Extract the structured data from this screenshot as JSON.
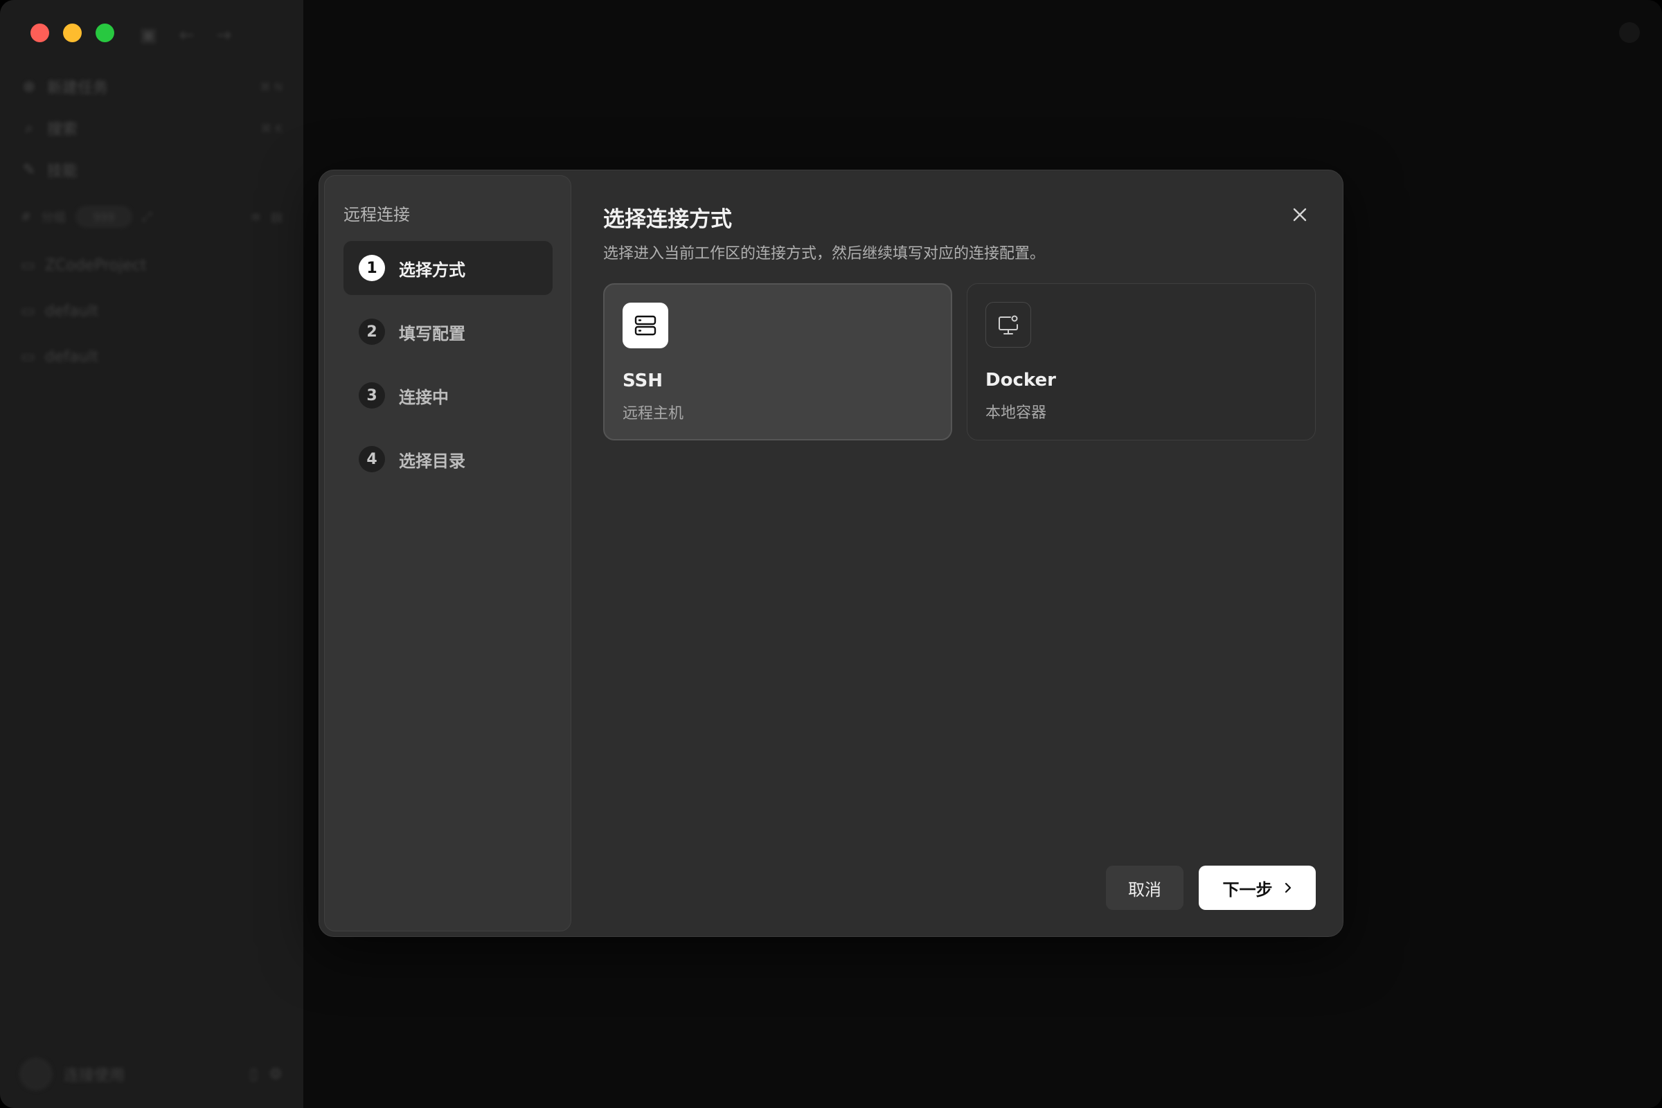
{
  "sidebar": {
    "items": [
      {
        "label": "新建任务",
        "icon": "plus-circle-icon",
        "shortcut": "⌘ N"
      },
      {
        "label": "搜索",
        "icon": "search-icon",
        "shortcut": "⌘ K"
      },
      {
        "label": "技能",
        "icon": "skills-icon",
        "shortcut": ""
      }
    ],
    "group_label": "分组",
    "group_pill": "999",
    "projects": [
      {
        "label": "ZCodeProject",
        "icon": "folder-icon"
      },
      {
        "label": "default",
        "icon": "folder-icon"
      },
      {
        "label": "default",
        "icon": "folder-icon"
      }
    ],
    "user_label": "连接使用"
  },
  "modal": {
    "panel_title": "远程连接",
    "steps": [
      {
        "number": "1",
        "label": "选择方式",
        "active": true
      },
      {
        "number": "2",
        "label": "填写配置",
        "active": false
      },
      {
        "number": "3",
        "label": "连接中",
        "active": false
      },
      {
        "number": "4",
        "label": "选择目录",
        "active": false
      }
    ],
    "title": "选择连接方式",
    "description": "选择进入当前工作区的连接方式，然后继续填写对应的连接配置。",
    "options": [
      {
        "name": "SSH",
        "subtitle": "远程主机",
        "icon": "server-icon",
        "selected": true
      },
      {
        "name": "Docker",
        "subtitle": "本地容器",
        "icon": "monitor-container-icon",
        "selected": false
      }
    ],
    "cancel_label": "取消",
    "next_label": "下一步",
    "close_icon": "close-icon"
  },
  "colors": {
    "modal_bg": "#2e2e2e",
    "panel_bg": "#353535",
    "primary_button_bg": "#ffffff",
    "traffic_red": "#fe5f57",
    "traffic_yellow": "#febc2e",
    "traffic_green": "#28c840"
  }
}
